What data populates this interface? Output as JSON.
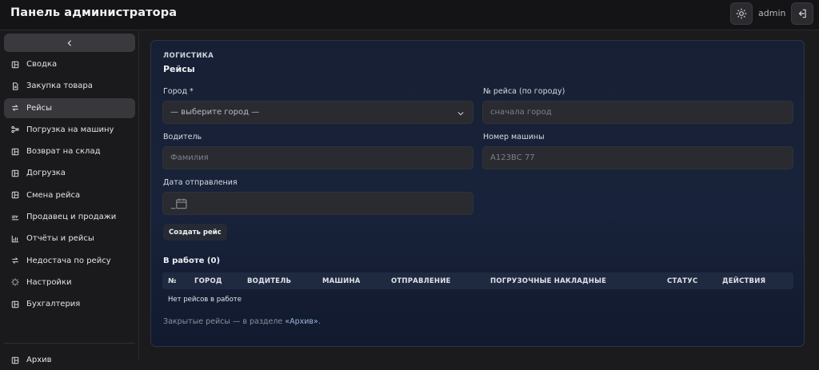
{
  "header": {
    "title": "Панель администратора",
    "user": "admin"
  },
  "sidebar": {
    "items": [
      {
        "label": "Сводка",
        "icon": "dashboard-icon"
      },
      {
        "label": "Закупка товара",
        "icon": "document-icon"
      },
      {
        "label": "Рейсы",
        "icon": "swap-arrows-icon",
        "active": true
      },
      {
        "label": "Погрузка на машину",
        "icon": "share-nodes-icon"
      },
      {
        "label": "Возврат на склад",
        "icon": "dashboard-icon"
      },
      {
        "label": "Догрузка",
        "icon": "dashboard-icon"
      },
      {
        "label": "Смена рейса",
        "icon": "dashboard-icon"
      },
      {
        "label": "Продавец и продажи",
        "icon": "seller-icon"
      },
      {
        "label": "Отчёты и рейсы",
        "icon": "bar-chart-icon"
      },
      {
        "label": "Недостача по рейсу",
        "icon": "swap-arrows-icon"
      },
      {
        "label": "Настройки",
        "icon": "loader-icon"
      },
      {
        "label": "Бухгалтерия",
        "icon": "dashboard-icon"
      }
    ],
    "archive_label": "Архив"
  },
  "main": {
    "section": "ЛОГИСТИКА",
    "title": "Рейсы",
    "form": {
      "city_label": "Город *",
      "city_value": "— выберите город —",
      "trip_number_label": "№ рейса (по городу)",
      "trip_number_placeholder": "сначала город",
      "driver_label": "Водитель",
      "driver_placeholder": "Фамилия",
      "car_number_label": "Номер машины",
      "car_number_placeholder": "А123ВС 77",
      "departure_label": "Дата отправления",
      "create_button": "Создать рейс"
    },
    "in_work_title": "В работе (0)",
    "table": {
      "columns": [
        "№",
        "ГОРОД",
        "ВОДИТЕЛЬ",
        "МАШИНА",
        "ОТПРАВЛЕНИЕ",
        "ПОГРУЗОЧНЫЕ НАКЛАДНЫЕ",
        "СТАТУС",
        "ДЕЙСТВИЯ"
      ],
      "empty_text": "Нет рейсов в работе"
    },
    "note_prefix": "Закрытые рейсы — в разделе ",
    "note_link": "«Архив»",
    "note_suffix": "."
  },
  "colors": {
    "accent_panel": "#172033",
    "active_item": "#37373c",
    "link": "#9fb3d9"
  }
}
